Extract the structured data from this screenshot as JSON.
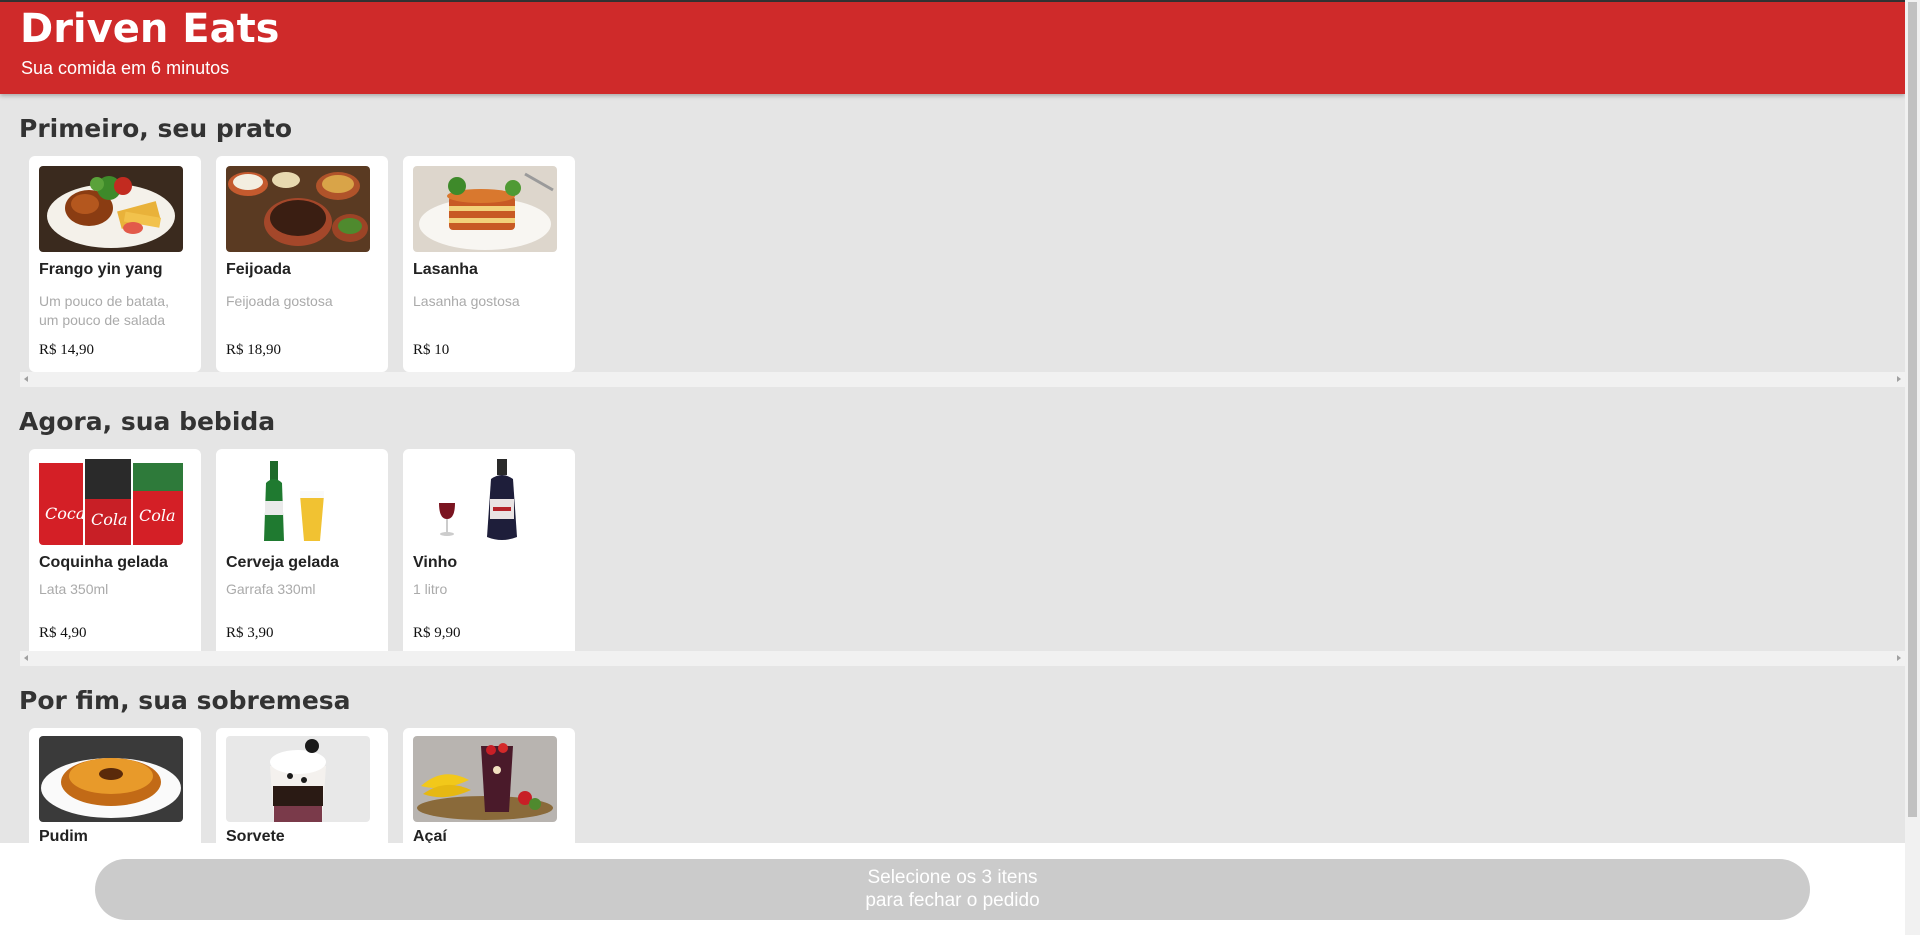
{
  "header": {
    "title": "Driven Eats",
    "subtitle": "Sua comida em 6 minutos"
  },
  "sections": [
    {
      "title": "Primeiro, seu prato",
      "items": [
        {
          "name": "Frango yin yang",
          "desc": "Um pouco de batata, um pouco de salada",
          "price": "R$ 14,90"
        },
        {
          "name": "Feijoada",
          "desc": "Feijoada gostosa",
          "price": "R$ 18,90"
        },
        {
          "name": "Lasanha",
          "desc": "Lasanha gostosa",
          "price": "R$ 10"
        }
      ]
    },
    {
      "title": "Agora, sua bebida",
      "items": [
        {
          "name": "Coquinha gelada",
          "desc": "Lata 350ml",
          "price": "R$ 4,90"
        },
        {
          "name": "Cerveja gelada",
          "desc": "Garrafa 330ml",
          "price": "R$ 3,90"
        },
        {
          "name": "Vinho",
          "desc": "1 litro",
          "price": "R$ 9,90"
        }
      ]
    },
    {
      "title": "Por fim, sua sobremesa",
      "items": [
        {
          "name": "Pudim"
        },
        {
          "name": "Sorvete"
        },
        {
          "name": "Açaí"
        }
      ]
    }
  ],
  "footer": {
    "line1": "Selecione os 3 itens",
    "line2": "para fechar o pedido"
  },
  "colors": {
    "brand": "#cf2a2a",
    "button_disabled": "#cbcbcb",
    "background": "#e5e5e5"
  }
}
